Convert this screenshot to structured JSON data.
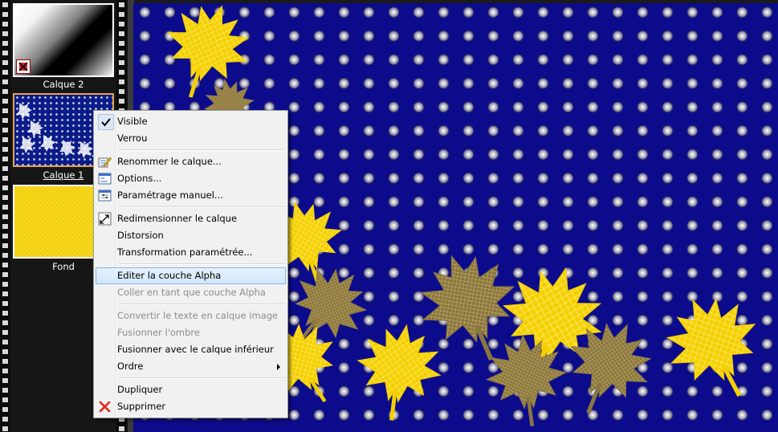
{
  "layers": [
    {
      "name": "Calque 2",
      "selected": false
    },
    {
      "name": "Calque 1",
      "selected": true
    },
    {
      "name": "Fond",
      "selected": false
    }
  ],
  "menu": {
    "visible": {
      "label": "Visible",
      "checked": true
    },
    "lock": {
      "label": "Verrou"
    },
    "rename": {
      "label": "Renommer le calque..."
    },
    "options": {
      "label": "Options..."
    },
    "manual_settings": {
      "label": "Paramétrage manuel..."
    },
    "resize": {
      "label": "Redimensionner le calque"
    },
    "distortion": {
      "label": "Distorsion"
    },
    "param_transform": {
      "label": "Transformation paramétrée..."
    },
    "edit_alpha": {
      "label": "Editer la couche Alpha",
      "highlighted": true
    },
    "paste_alpha": {
      "label": "Coller en tant que couche Alpha",
      "disabled": true
    },
    "convert_text": {
      "label": "Convertir le texte en calque image",
      "disabled": true
    },
    "merge_shadow": {
      "label": "Fusionner l'ombre",
      "disabled": true
    },
    "merge_lower": {
      "label": "Fusionner avec le calque inférieur"
    },
    "order": {
      "label": "Ordre",
      "has_submenu": true
    },
    "duplicate": {
      "label": "Dupliquer"
    },
    "delete": {
      "label": "Supprimer"
    }
  },
  "colors": {
    "canvas_blue": "#0b0b8c",
    "leaf_yellow": "#f5d000",
    "leaf_brown": "#a08a3c",
    "selection_orange": "#e3a54a",
    "menu_highlight": "#d2e7f9"
  }
}
